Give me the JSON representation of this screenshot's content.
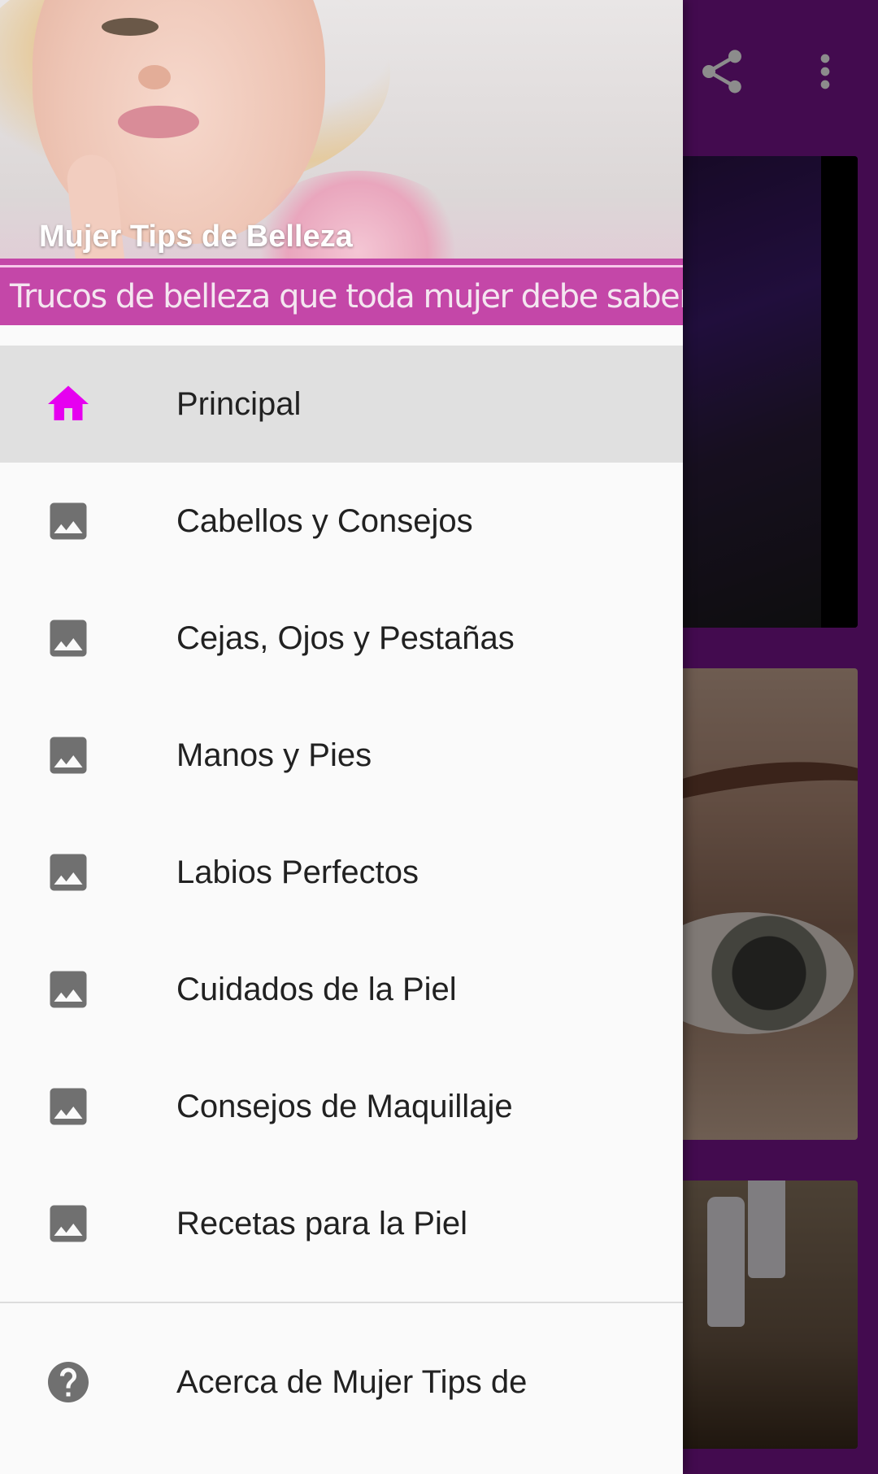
{
  "app_bar": {
    "share_icon": "share-icon",
    "more_icon": "more-vert-icon"
  },
  "drawer": {
    "header": {
      "title": "Mujer Tips de Belleza",
      "tagline": "Trucos de belleza que toda mujer debe saber"
    },
    "items": [
      {
        "label": "Principal",
        "icon": "home-icon",
        "active": true
      },
      {
        "label": "Cabellos y Consejos",
        "icon": "image-icon"
      },
      {
        "label": "Cejas, Ojos y Pestañas",
        "icon": "image-icon"
      },
      {
        "label": "Manos y Pies",
        "icon": "image-icon"
      },
      {
        "label": "Labios Perfectos",
        "icon": "image-icon"
      },
      {
        "label": "Cuidados de la Piel",
        "icon": "image-icon"
      },
      {
        "label": "Consejos de Maquillaje",
        "icon": "image-icon"
      },
      {
        "label": "Recetas para la Piel",
        "icon": "image-icon"
      }
    ],
    "about": {
      "label": "Acerca de Mujer Tips de",
      "icon": "help-icon"
    }
  },
  "colors": {
    "accent": "#e600f0",
    "app_bar": "#7a1590",
    "banner": "#c447a8",
    "icon_gray": "#707070"
  }
}
